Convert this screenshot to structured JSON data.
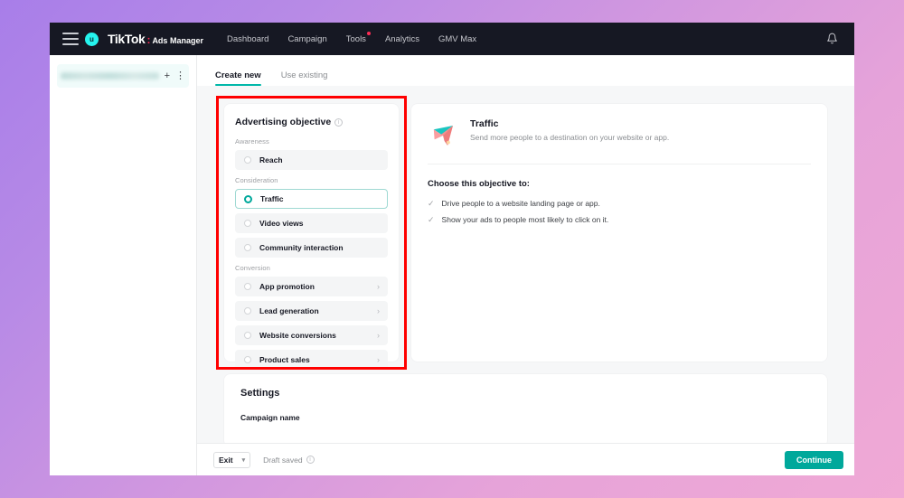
{
  "topnav": {
    "menu_icon": "hamburger-menu-icon",
    "avatar_initial": "u",
    "brand_name": "TikTok",
    "brand_separator": ":",
    "brand_sub": "Ads Manager",
    "links": [
      {
        "label": "Dashboard",
        "dot": false
      },
      {
        "label": "Campaign",
        "dot": false
      },
      {
        "label": "Tools",
        "dot": true
      },
      {
        "label": "Analytics",
        "dot": false
      },
      {
        "label": "GMV Max",
        "dot": false
      }
    ],
    "bell_icon": "notification-bell-icon"
  },
  "sidebar": {
    "add_icon": "+",
    "more_icon": "⋮"
  },
  "tabs": [
    {
      "label": "Create new",
      "active": true
    },
    {
      "label": "Use existing",
      "active": false
    }
  ],
  "objective": {
    "title": "Advertising objective",
    "info_icon": "info-icon",
    "groups": [
      {
        "label": "Awareness",
        "options": [
          {
            "label": "Reach",
            "selected": false,
            "chevron": false
          }
        ]
      },
      {
        "label": "Consideration",
        "options": [
          {
            "label": "Traffic",
            "selected": true,
            "chevron": false
          },
          {
            "label": "Video views",
            "selected": false,
            "chevron": false
          },
          {
            "label": "Community interaction",
            "selected": false,
            "chevron": false
          }
        ]
      },
      {
        "label": "Conversion",
        "options": [
          {
            "label": "App promotion",
            "selected": false,
            "chevron": true
          },
          {
            "label": "Lead generation",
            "selected": false,
            "chevron": true
          },
          {
            "label": "Website conversions",
            "selected": false,
            "chevron": true
          },
          {
            "label": "Product sales",
            "selected": false,
            "chevron": true
          }
        ]
      }
    ]
  },
  "detail": {
    "icon": "paper-plane-icon",
    "name": "Traffic",
    "description": "Send more people to a destination on your website or app.",
    "choose_heading": "Choose this objective to:",
    "bullets": [
      "Drive people to a website landing page or app.",
      "Show your ads to people most likely to click on it."
    ]
  },
  "settings": {
    "title": "Settings",
    "campaign_name_label": "Campaign name"
  },
  "bottom_bar": {
    "exit_label": "Exit",
    "exit_chevron": "⌄",
    "draft_label": "Draft saved",
    "draft_info_icon": "info-icon",
    "continue_label": "Continue"
  },
  "colors": {
    "accent_teal": "#00a89b",
    "brand_red": "#ff2b55",
    "nav_dark": "#161823",
    "annotation_red": "#ff0000",
    "avatar_cyan": "#25f4ee"
  }
}
